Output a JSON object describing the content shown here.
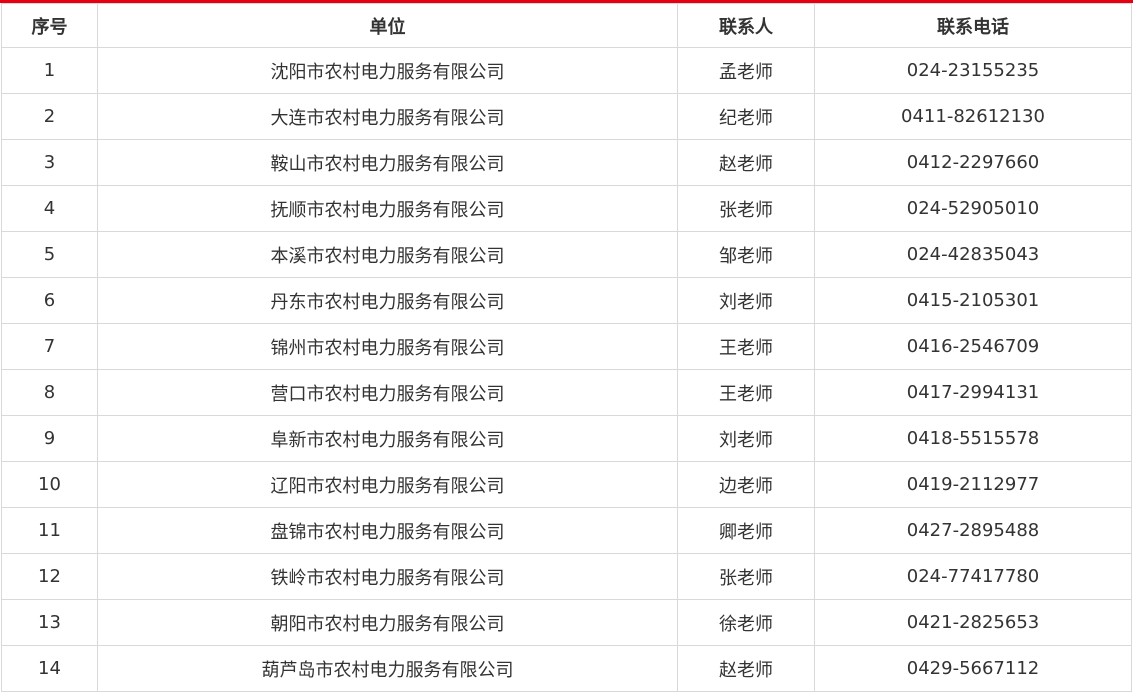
{
  "theme": {
    "accent_color": "#e60012",
    "border_color": "#d9d9d9",
    "text_color": "#333333"
  },
  "table": {
    "headers": {
      "index": "序号",
      "unit": "单位",
      "contact": "联系人",
      "phone": "联系电话"
    },
    "rows": [
      {
        "index": "1",
        "unit": "沈阳市农村电力服务有限公司",
        "contact": "孟老师",
        "phone": "024-23155235"
      },
      {
        "index": "2",
        "unit": "大连市农村电力服务有限公司",
        "contact": "纪老师",
        "phone": "0411-82612130"
      },
      {
        "index": "3",
        "unit": "鞍山市农村电力服务有限公司",
        "contact": "赵老师",
        "phone": "0412-2297660"
      },
      {
        "index": "4",
        "unit": "抚顺市农村电力服务有限公司",
        "contact": "张老师",
        "phone": "024-52905010"
      },
      {
        "index": "5",
        "unit": "本溪市农村电力服务有限公司",
        "contact": "邹老师",
        "phone": "024-42835043"
      },
      {
        "index": "6",
        "unit": "丹东市农村电力服务有限公司",
        "contact": "刘老师",
        "phone": "0415-2105301"
      },
      {
        "index": "7",
        "unit": "锦州市农村电力服务有限公司",
        "contact": "王老师",
        "phone": "0416-2546709"
      },
      {
        "index": "8",
        "unit": "营口市农村电力服务有限公司",
        "contact": "王老师",
        "phone": "0417-2994131"
      },
      {
        "index": "9",
        "unit": "阜新市农村电力服务有限公司",
        "contact": "刘老师",
        "phone": "0418-5515578"
      },
      {
        "index": "10",
        "unit": "辽阳市农村电力服务有限公司",
        "contact": "边老师",
        "phone": "0419-2112977"
      },
      {
        "index": "11",
        "unit": "盘锦市农村电力服务有限公司",
        "contact": "卿老师",
        "phone": "0427-2895488"
      },
      {
        "index": "12",
        "unit": "铁岭市农村电力服务有限公司",
        "contact": "张老师",
        "phone": "024-77417780"
      },
      {
        "index": "13",
        "unit": "朝阳市农村电力服务有限公司",
        "contact": "徐老师",
        "phone": "0421-2825653"
      },
      {
        "index": "14",
        "unit": "葫芦岛市农村电力服务有限公司",
        "contact": "赵老师",
        "phone": "0429-5667112"
      }
    ]
  }
}
